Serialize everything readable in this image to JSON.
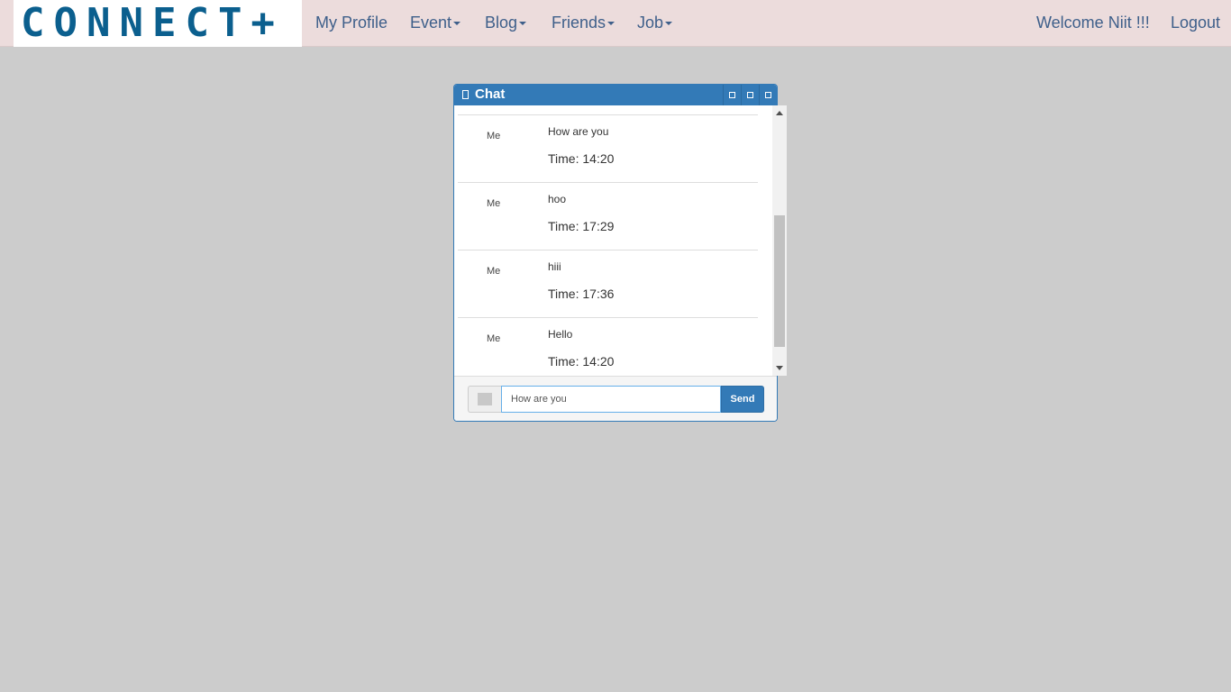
{
  "navbar": {
    "brand": "CONNECT+",
    "items": [
      {
        "label": "My Profile",
        "dropdown": false
      },
      {
        "label": "Event",
        "dropdown": true
      },
      {
        "label": "Blog",
        "dropdown": true
      },
      {
        "label": "Friends",
        "dropdown": true
      },
      {
        "label": "Job",
        "dropdown": true
      }
    ],
    "welcome": "Welcome Niit !!!",
    "logout": "Logout"
  },
  "chat": {
    "title": "Chat",
    "header_buttons": [
      "minimize-icon",
      "maximize-icon",
      "close-icon"
    ],
    "messages": [
      {
        "sender": "Me",
        "text": "How are you",
        "time": "Time: 14:20"
      },
      {
        "sender": "Me",
        "text": "hoo",
        "time": "Time: 17:29"
      },
      {
        "sender": "Me",
        "text": "hiii",
        "time": "Time: 17:36"
      },
      {
        "sender": "Me",
        "text": "Hello",
        "time": "Time: 14:20"
      }
    ],
    "input_value": "How are you",
    "send_label": "Send"
  },
  "colors": {
    "navbar_bg": "#ecdcdc",
    "page_bg": "#cccccc",
    "primary": "#337ab7",
    "brand": "#0b5f8e",
    "nav_text": "#3e5f8a"
  }
}
